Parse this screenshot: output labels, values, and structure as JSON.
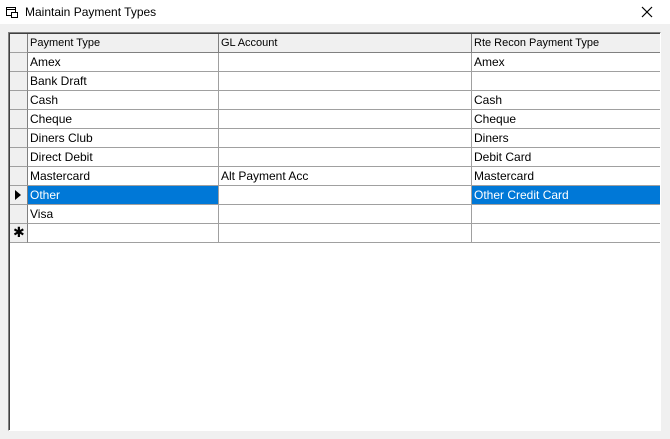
{
  "window": {
    "title": "Maintain Payment Types",
    "close_glyph": "✕"
  },
  "grid": {
    "columns": [
      "Payment Type",
      "GL Account",
      "Rte Recon Payment Type"
    ],
    "rows": [
      [
        "Amex",
        "",
        "Amex"
      ],
      [
        "Bank Draft",
        "",
        ""
      ],
      [
        "Cash",
        "",
        "Cash"
      ],
      [
        "Cheque",
        "",
        "Cheque"
      ],
      [
        "Diners Club",
        "",
        "Diners"
      ],
      [
        "Direct Debit",
        "",
        "Debit Card"
      ],
      [
        "Mastercard",
        "Alt Payment Acc",
        "Mastercard"
      ],
      [
        "Other",
        "",
        "Other Credit Card"
      ],
      [
        "Visa",
        "",
        ""
      ]
    ],
    "selected_row_index": 7,
    "new_row_glyph": "✱",
    "selection_color": "#0078d7"
  }
}
